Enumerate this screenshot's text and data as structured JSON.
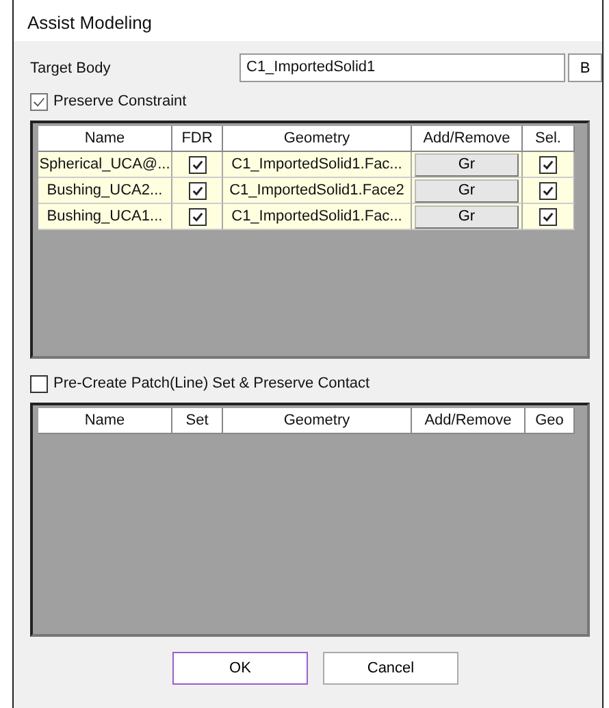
{
  "window": {
    "title": "Assist Modeling"
  },
  "target_body": {
    "label": "Target Body",
    "value": "C1_ImportedSolid1",
    "button": "B"
  },
  "preserve_constraint": {
    "label": "Preserve Constraint",
    "checked": true
  },
  "constraint_table": {
    "columns": [
      "Name",
      "FDR",
      "Geometry",
      "Add/Remove",
      "Sel."
    ],
    "rows": [
      {
        "name": "Spherical_UCA@...",
        "fdr": true,
        "geometry": "C1_ImportedSolid1.Fac...",
        "action": "Gr",
        "sel": true
      },
      {
        "name": "Bushing_UCA2...",
        "fdr": true,
        "geometry": "C1_ImportedSolid1.Face2",
        "action": "Gr",
        "sel": true
      },
      {
        "name": "Bushing_UCA1...",
        "fdr": true,
        "geometry": "C1_ImportedSolid1.Fac...",
        "action": "Gr",
        "sel": true
      }
    ]
  },
  "pre_create": {
    "label": "Pre-Create Patch(Line) Set & Preserve Contact",
    "checked": false
  },
  "contact_table": {
    "columns": [
      "Name",
      "Set",
      "Geometry",
      "Add/Remove",
      "Geo"
    ]
  },
  "buttons": [
    "OK",
    "Cancel"
  ]
}
